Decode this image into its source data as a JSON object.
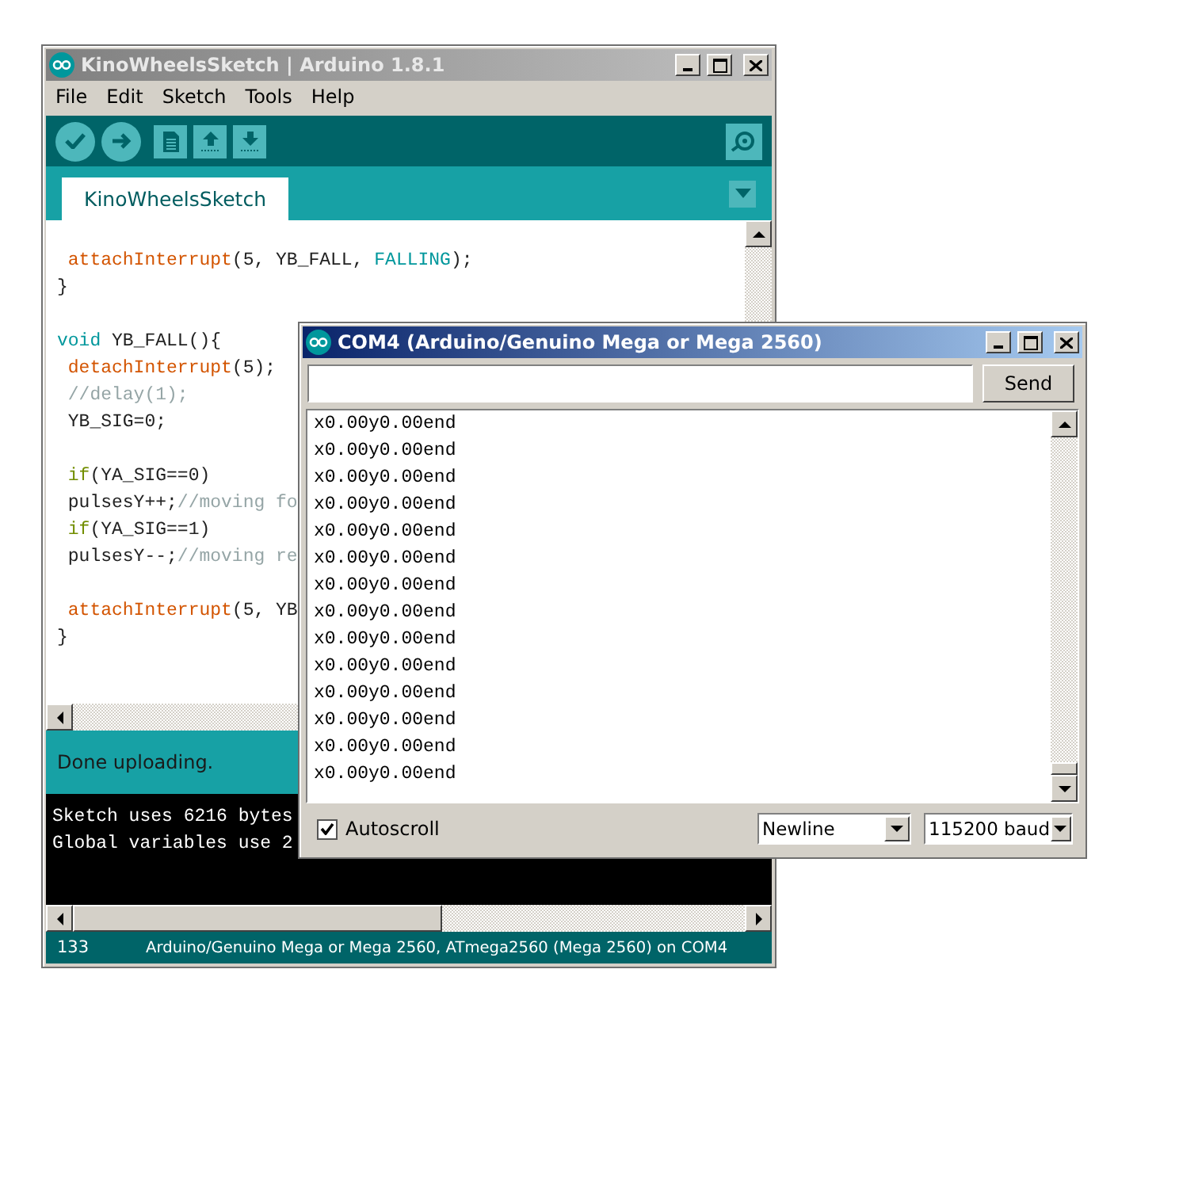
{
  "main_window": {
    "title": "KinoWheelsSketch | Arduino 1.8.1",
    "active": false,
    "menu": [
      "File",
      "Edit",
      "Sketch",
      "Tools",
      "Help"
    ],
    "tabs": [
      {
        "label": "KinoWheelsSketch",
        "selected": true
      }
    ],
    "code_blocks": [
      [
        [
          {
            "text": " attachInterrupt",
            "kind": "fn"
          },
          {
            "text": "(5, YB_FALL, ",
            "kind": "plain"
          },
          {
            "text": "FALLING",
            "kind": "const"
          },
          {
            "text": ");",
            "kind": "plain"
          }
        ],
        [
          {
            "text": "}",
            "kind": "plain"
          }
        ]
      ],
      [
        [
          {
            "text": "void",
            "kind": "type"
          },
          {
            "text": " YB_FALL(){",
            "kind": "plain"
          }
        ],
        [
          {
            "text": " detachInterrupt",
            "kind": "fn"
          },
          {
            "text": "(5);",
            "kind": "plain"
          }
        ],
        [
          {
            "text": " //delay(1);",
            "kind": "comment"
          }
        ],
        [
          {
            "text": " YB_SIG=0;",
            "kind": "plain"
          }
        ]
      ],
      [
        [
          {
            "text": " if",
            "kind": "ctrl"
          },
          {
            "text": "(YA_SIG==0)",
            "kind": "plain"
          }
        ],
        [
          {
            "text": " pulsesY++;",
            "kind": "plain"
          },
          {
            "text": "//moving fo",
            "kind": "comment"
          }
        ],
        [
          {
            "text": " if",
            "kind": "ctrl"
          },
          {
            "text": "(YA_SIG==1)",
            "kind": "plain"
          }
        ],
        [
          {
            "text": " pulsesY--;",
            "kind": "plain"
          },
          {
            "text": "//moving re",
            "kind": "comment"
          }
        ]
      ],
      [
        [
          {
            "text": " attachInterrupt",
            "kind": "fn"
          },
          {
            "text": "(5, YB",
            "kind": "plain"
          }
        ],
        [
          {
            "text": "}",
            "kind": "plain"
          }
        ]
      ]
    ],
    "status_message": "Done uploading.",
    "console": [
      "Sketch uses 6216 bytes",
      "Global variables use 2"
    ],
    "status_bar": {
      "line": "133",
      "board": "Arduino/Genuino Mega or Mega 2560, ATmega2560 (Mega 2560) on COM4"
    }
  },
  "serial_monitor": {
    "title": "COM4 (Arduino/Genuino Mega or Mega 2560)",
    "active": true,
    "send_button": "Send",
    "output": [
      "x0.00y0.00end",
      "x0.00y0.00end",
      "x0.00y0.00end",
      "x0.00y0.00end",
      "x0.00y0.00end",
      "x0.00y0.00end",
      "x0.00y0.00end",
      "x0.00y0.00end",
      "x0.00y0.00end",
      "x0.00y0.00end",
      "x0.00y0.00end",
      "x0.00y0.00end",
      "x0.00y0.00end",
      "x0.00y0.00end"
    ],
    "autoscroll": {
      "label": "Autoscroll",
      "checked": true
    },
    "line_ending": "Newline",
    "baud_rate": "115200 baud"
  }
}
